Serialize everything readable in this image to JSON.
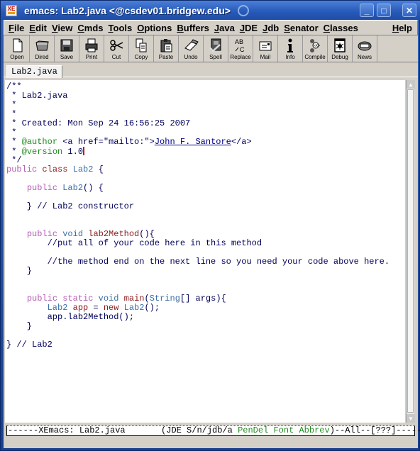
{
  "window": {
    "title": "emacs: Lab2.java <@csdev01.bridgew.edu>",
    "app_icon": "xemacs-icon",
    "controls": [
      "minimize",
      "maximize",
      "close"
    ]
  },
  "menubar": {
    "items": [
      {
        "label": "File",
        "u": "F",
        "rest": "ile"
      },
      {
        "label": "Edit",
        "u": "E",
        "rest": "dit"
      },
      {
        "label": "View",
        "u": "V",
        "rest": "iew"
      },
      {
        "label": "Cmds",
        "u": "C",
        "rest": "mds"
      },
      {
        "label": "Tools",
        "u": "T",
        "rest": "ools"
      },
      {
        "label": "Options",
        "u": "O",
        "rest": "ptions"
      },
      {
        "label": "Buffers",
        "u": "B",
        "rest": "uffers"
      },
      {
        "label": "Java",
        "u": "J",
        "rest": "ava"
      },
      {
        "label": "JDE",
        "u": "J",
        "rest": "DE"
      },
      {
        "label": "Jdb",
        "u": "J",
        "rest": "db"
      },
      {
        "label": "Senator",
        "u": "S",
        "rest": "enator"
      },
      {
        "label": "Classes",
        "u": "C",
        "rest": "lasses"
      }
    ],
    "help": {
      "label": "Help",
      "u": "H",
      "rest": "elp"
    }
  },
  "toolbar": {
    "buttons": [
      {
        "label": "Open",
        "icon": "open-file-icon"
      },
      {
        "label": "Dired",
        "icon": "folder-icon"
      },
      {
        "label": "Save",
        "icon": "floppy-disk-icon"
      },
      {
        "label": "Print",
        "icon": "printer-icon"
      },
      {
        "label": "Cut",
        "icon": "scissors-icon"
      },
      {
        "label": "Copy",
        "icon": "copy-icon"
      },
      {
        "label": "Paste",
        "icon": "clipboard-icon"
      },
      {
        "label": "Undo",
        "icon": "eraser-icon"
      },
      {
        "label": "Spell",
        "icon": "spellbook-icon"
      },
      {
        "label": "Replace",
        "icon": "replace-icon"
      },
      {
        "label": "Mail",
        "icon": "mail-icon"
      },
      {
        "label": "Info",
        "icon": "info-icon"
      },
      {
        "label": "Compile",
        "icon": "gears-icon"
      },
      {
        "label": "Debug",
        "icon": "bug-icon"
      },
      {
        "label": "News",
        "icon": "newspaper-icon"
      }
    ]
  },
  "buffer_tab": {
    "label": "Lab2.java"
  },
  "editor": {
    "lines": [
      [
        {
          "t": "/**",
          "c": "cm"
        }
      ],
      [
        {
          "t": " * Lab2.java",
          "c": "cm"
        }
      ],
      [
        {
          "t": " *",
          "c": "cm"
        }
      ],
      [
        {
          "t": " *",
          "c": "cm"
        }
      ],
      [
        {
          "t": " * Created: Mon Sep 24 16:56:25 2007",
          "c": "cm"
        }
      ],
      [
        {
          "t": " *",
          "c": "cm"
        }
      ],
      [
        {
          "t": " * ",
          "c": "cm"
        },
        {
          "t": "@author",
          "c": "doc"
        },
        {
          "t": " <a href=\"mailto:\">",
          "c": "cm"
        },
        {
          "t": "John F. Santore",
          "c": "link"
        },
        {
          "t": "</a>",
          "c": "cm"
        }
      ],
      [
        {
          "t": " * ",
          "c": "cm"
        },
        {
          "t": "@version",
          "c": "doc"
        },
        {
          "t": " 1.0",
          "c": "cm"
        },
        {
          "t": "",
          "c": "cursor"
        }
      ],
      [
        {
          "t": " */",
          "c": "cm"
        }
      ],
      [
        {
          "t": "public",
          "c": "kw"
        },
        {
          "t": " ",
          "c": ""
        },
        {
          "t": "class",
          "c": "fn"
        },
        {
          "t": " ",
          "c": ""
        },
        {
          "t": "Lab2",
          "c": "ty"
        },
        {
          "t": " {",
          "c": ""
        }
      ],
      [
        {
          "t": "",
          "c": ""
        }
      ],
      [
        {
          "t": "    ",
          "c": ""
        },
        {
          "t": "public",
          "c": "kw"
        },
        {
          "t": " ",
          "c": ""
        },
        {
          "t": "Lab2",
          "c": "ty"
        },
        {
          "t": "() {",
          "c": ""
        }
      ],
      [
        {
          "t": "",
          "c": ""
        }
      ],
      [
        {
          "t": "    } // Lab2 constructor",
          "c": ""
        }
      ],
      [
        {
          "t": "",
          "c": ""
        }
      ],
      [
        {
          "t": "",
          "c": ""
        }
      ],
      [
        {
          "t": "    ",
          "c": ""
        },
        {
          "t": "public",
          "c": "kw"
        },
        {
          "t": " ",
          "c": ""
        },
        {
          "t": "void",
          "c": "ty"
        },
        {
          "t": " ",
          "c": ""
        },
        {
          "t": "lab2Method",
          "c": "fn"
        },
        {
          "t": "(){",
          "c": ""
        }
      ],
      [
        {
          "t": "        //put all of your code here in this method",
          "c": ""
        }
      ],
      [
        {
          "t": "",
          "c": ""
        }
      ],
      [
        {
          "t": "        //the method end on the next line so you need your code above here.",
          "c": ""
        }
      ],
      [
        {
          "t": "    }",
          "c": ""
        }
      ],
      [
        {
          "t": "",
          "c": ""
        }
      ],
      [
        {
          "t": "",
          "c": ""
        }
      ],
      [
        {
          "t": "    ",
          "c": ""
        },
        {
          "t": "public",
          "c": "kw"
        },
        {
          "t": " ",
          "c": ""
        },
        {
          "t": "static",
          "c": "kw"
        },
        {
          "t": " ",
          "c": ""
        },
        {
          "t": "void",
          "c": "ty"
        },
        {
          "t": " ",
          "c": ""
        },
        {
          "t": "main",
          "c": "fn"
        },
        {
          "t": "(",
          "c": ""
        },
        {
          "t": "String",
          "c": "ty"
        },
        {
          "t": "[] args){",
          "c": ""
        }
      ],
      [
        {
          "t": "        ",
          "c": ""
        },
        {
          "t": "Lab2",
          "c": "ty"
        },
        {
          "t": " ",
          "c": ""
        },
        {
          "t": "app",
          "c": "fn"
        },
        {
          "t": " = ",
          "c": ""
        },
        {
          "t": "new",
          "c": "fn"
        },
        {
          "t": " ",
          "c": ""
        },
        {
          "t": "Lab2",
          "c": "ty"
        },
        {
          "t": "();",
          "c": ""
        }
      ],
      [
        {
          "t": "        app.lab2Method();",
          "c": ""
        }
      ],
      [
        {
          "t": "    }",
          "c": ""
        }
      ],
      [
        {
          "t": "",
          "c": ""
        }
      ],
      [
        {
          "t": "} // Lab2",
          "c": ""
        }
      ]
    ]
  },
  "modeline": {
    "prefix": "------XEmacs: Lab2.java       (JDE S/n/jdb/a ",
    "minor_modes": "PenDel Font Abbrev",
    "suffix": ")--All--[???]------"
  }
}
